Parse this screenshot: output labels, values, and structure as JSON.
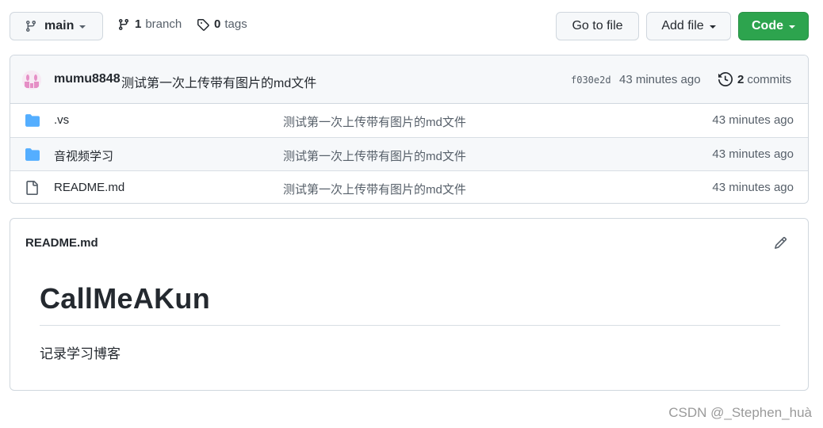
{
  "toolbar": {
    "branch_name": "main",
    "branches_count": "1",
    "branches_label": "branch",
    "tags_count": "0",
    "tags_label": "tags",
    "go_to_file_label": "Go to file",
    "add_file_label": "Add file",
    "code_label": "Code"
  },
  "commit": {
    "author": "mumu8848",
    "message": "测试第一次上传带有图片的md文件",
    "sha": "f030e2d",
    "time": "43 minutes ago",
    "commits_count": "2",
    "commits_label": "commits"
  },
  "files": [
    {
      "name": ".vs",
      "type": "folder",
      "message": "测试第一次上传带有图片的md文件",
      "time": "43 minutes ago"
    },
    {
      "name": "音视频学习",
      "type": "folder",
      "message": "测试第一次上传带有图片的md文件",
      "time": "43 minutes ago"
    },
    {
      "name": "README.md",
      "type": "file",
      "message": "测试第一次上传带有图片的md文件",
      "time": "43 minutes ago"
    }
  ],
  "readme": {
    "filename": "README.md",
    "heading": "CallMeAKun",
    "body": "记录学习博客"
  },
  "watermark": "CSDN @_Stephen_huà",
  "colors": {
    "primary_button": "#2da44e",
    "folder_icon": "#54aeff",
    "border": "#d0d7de"
  },
  "icons": {
    "branch": "git-branch-icon",
    "tag": "tag-icon",
    "history": "history-icon",
    "folder": "folder-icon",
    "file": "file-icon",
    "pencil": "pencil-icon"
  }
}
